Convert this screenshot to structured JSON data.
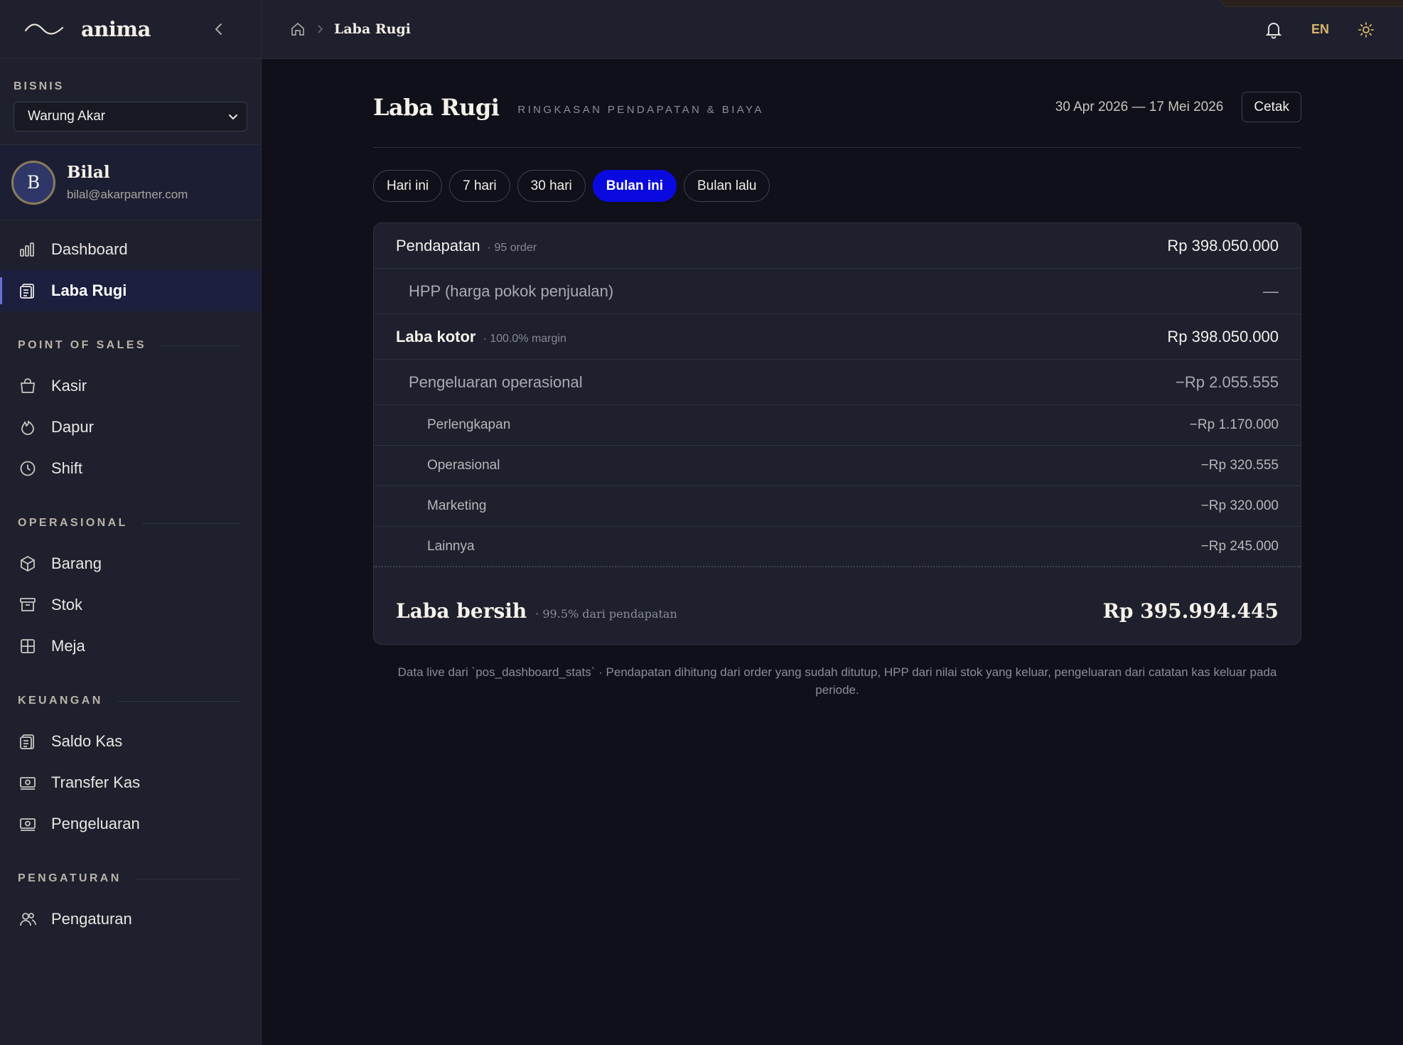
{
  "brand": {
    "name": "anima"
  },
  "business": {
    "label": "BISNIS",
    "selected": "Warung Akar"
  },
  "user": {
    "initial": "B",
    "name": "Bilal",
    "email": "bilal@akarpartner.com"
  },
  "nav": {
    "top": [
      {
        "label": "Dashboard",
        "icon": "bar-chart-icon"
      },
      {
        "label": "Laba Rugi",
        "icon": "clipboard-icon",
        "active": true
      }
    ],
    "sections": [
      {
        "title": "POINT OF SALES",
        "items": [
          {
            "label": "Kasir",
            "icon": "shopping-bag-icon"
          },
          {
            "label": "Dapur",
            "icon": "flame-icon"
          },
          {
            "label": "Shift",
            "icon": "clock-icon"
          }
        ]
      },
      {
        "title": "OPERASIONAL",
        "items": [
          {
            "label": "Barang",
            "icon": "box-icon"
          },
          {
            "label": "Stok",
            "icon": "archive-icon"
          },
          {
            "label": "Meja",
            "icon": "grid-icon"
          }
        ]
      },
      {
        "title": "KEUANGAN",
        "items": [
          {
            "label": "Saldo Kas",
            "icon": "clipboard-icon"
          },
          {
            "label": "Transfer Kas",
            "icon": "banknote-icon"
          },
          {
            "label": "Pengeluaran",
            "icon": "banknote-icon"
          }
        ]
      },
      {
        "title": "PENGATURAN",
        "items": [
          {
            "label": "Pengaturan",
            "icon": "users-icon"
          }
        ]
      }
    ]
  },
  "topbar": {
    "breadcrumb_current": "Laba Rugi",
    "language": "EN"
  },
  "page": {
    "title": "Laba Rugi",
    "subtitle": "RINGKASAN PENDAPATAN & BIAYA",
    "date_range": "30 Apr 2026 — 17 Mei 2026",
    "print_label": "Cetak",
    "tabs": [
      {
        "label": "Hari ini"
      },
      {
        "label": "7 hari"
      },
      {
        "label": "30 hari"
      },
      {
        "label": "Bulan ini",
        "active": true
      },
      {
        "label": "Bulan lalu"
      }
    ]
  },
  "report": {
    "revenue": {
      "label": "Pendapatan",
      "meta": "· 95 order",
      "value": "Rp 398.050.000"
    },
    "cogs": {
      "label": "HPP (harga pokok penjualan)",
      "value": "—"
    },
    "gross": {
      "label": "Laba kotor",
      "meta": "· 100.0% margin",
      "value": "Rp 398.050.000"
    },
    "opex": {
      "label": "Pengeluaran operasional",
      "value": "−Rp 2.055.555"
    },
    "opex_items": [
      {
        "label": "Perlengkapan",
        "value": "−Rp 1.170.000"
      },
      {
        "label": "Operasional",
        "value": "−Rp 320.555"
      },
      {
        "label": "Marketing",
        "value": "−Rp 320.000"
      },
      {
        "label": "Lainnya",
        "value": "−Rp 245.000"
      }
    ],
    "net": {
      "label": "Laba bersih",
      "meta": "· 99.5% dari pendapatan",
      "value": "Rp 395.994.445"
    }
  },
  "footnote": "Data live dari `pos_dashboard_stats` · Pendapatan dihitung dari order yang sudah ditutup, HPP dari nilai stok yang keluar, pengeluaran dari catatan kas keluar pada periode.",
  "colors": {
    "accent": "#0a0ae0",
    "gold": "#d8b66a",
    "background": "#0f1019",
    "panel": "#1e202d"
  }
}
